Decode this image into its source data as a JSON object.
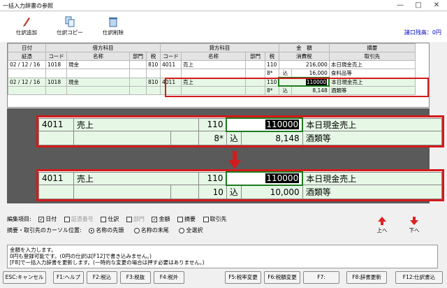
{
  "window": {
    "title": "一括入力辞書の参照",
    "min": "—",
    "max": "□",
    "close": "✕"
  },
  "toolbar": [
    {
      "label": "仕訳追加",
      "icon": "pencil-icon"
    },
    {
      "label": "仕訳コピー",
      "icon": "copy-icon"
    },
    {
      "label": "仕訳削除",
      "icon": "trash-icon"
    }
  ],
  "seki": "諸口残高：0円",
  "grid": {
    "group_headers": {
      "date": "日付",
      "debit": "借方科目",
      "credit": "貸方科目",
      "amount": "金　額",
      "memo": "摘要"
    },
    "sub_headers": [
      "証憑",
      "コード",
      "名称",
      "部門",
      "税",
      "コード",
      "名称",
      "部門",
      "税",
      "消費税",
      "取引先"
    ],
    "rows": [
      {
        "date": "02 / 12 / 16",
        "dcode": "1018",
        "dname": "現金",
        "ddept": "",
        "dtax": "810",
        "ccode": "4011",
        "cname": "売上",
        "cdept": "",
        "ctax": "110",
        "amount": "216,000",
        "memo": "本日現金売上"
      },
      {
        "ctax": "8*",
        "taxin": "込",
        "amount": "16,000",
        "memo": "食料品等"
      },
      {
        "date": "02 / 12 / 16",
        "dcode": "1018",
        "dname": "現金",
        "ddept": "",
        "dtax": "810",
        "ccode": "4011",
        "cname": "売上",
        "cdept": "",
        "ctax": "110",
        "amount": "110000",
        "memo": "本日現金売上"
      },
      {
        "ctax": "8*",
        "taxin": "込",
        "amount": "8,148",
        "memo": "酒類等"
      }
    ]
  },
  "zoom_before": {
    "code": "4011",
    "name": "売上",
    "tax": "110",
    "amount": "110000",
    "memo": "本日現金売上",
    "rate": "8*",
    "taxin": "込",
    "tax_amount": "8,148",
    "memo2": "酒類等"
  },
  "zoom_after": {
    "code": "4011",
    "name": "売上",
    "tax": "110",
    "amount": "110000",
    "memo": "本日現金売上",
    "rate": "10",
    "taxin": "込",
    "tax_amount": "10,000",
    "memo2": "酒類等"
  },
  "options": {
    "edit_items_label": "編集項目:",
    "items": [
      {
        "label": "日付",
        "checked": true,
        "disabled": false
      },
      {
        "label": "証憑番号",
        "checked": false,
        "disabled": true
      },
      {
        "label": "仕訳",
        "checked": false,
        "disabled": false
      },
      {
        "label": "部門",
        "checked": false,
        "disabled": true
      },
      {
        "label": "金額",
        "checked": true,
        "disabled": false
      },
      {
        "label": "摘要",
        "checked": false,
        "disabled": false
      },
      {
        "label": "取引先",
        "checked": false,
        "disabled": false
      }
    ],
    "cursor_label": "摘要・取引先のカーソル位置:",
    "cursor_opts": [
      {
        "label": "名称の先頭",
        "selected": true
      },
      {
        "label": "名称の末尾",
        "selected": false
      },
      {
        "label": "全選択",
        "selected": false
      }
    ],
    "up": "上へ",
    "down": "下へ"
  },
  "message": {
    "line1": "金額を入力します。",
    "line2": "0円も登録可能です。(0円の仕訳は[F12]で書き込みません。)",
    "line3": "[F8]で一括入力辞書を更新します。(一時的な変更の場合は押す必要はありません。)"
  },
  "fkeys": [
    "ESC:キャンセル",
    "F1:ヘルプ",
    "F2:税込",
    "F3:税抜",
    "F4:税外",
    "F5:税率変更",
    "F6:税額変更",
    "F7:",
    "F8:辞書更新",
    "F12:仕訳書込"
  ],
  "colors": {
    "accent_red": "#d21b1b",
    "focus_green": "#1f7a1f"
  }
}
